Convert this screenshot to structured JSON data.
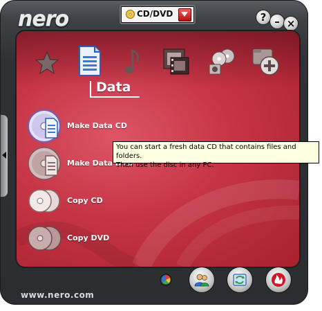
{
  "app": {
    "logo_text": "nero",
    "footer_url": "www.nero.com"
  },
  "mode_selector": {
    "selected": "CD/DVD",
    "icon": "cd-dvd-disc-icon"
  },
  "window_controls": {
    "help": "?",
    "minimize": "–",
    "close": "×"
  },
  "categories": [
    {
      "id": "favorites",
      "icon": "star-icon"
    },
    {
      "id": "data",
      "icon": "document-icon",
      "selected": true
    },
    {
      "id": "audio",
      "icon": "music-note-icon"
    },
    {
      "id": "photo-video",
      "icon": "film-icon"
    },
    {
      "id": "copy-backup",
      "icon": "discs-icon"
    },
    {
      "id": "extras",
      "icon": "add-icon"
    }
  ],
  "section": {
    "title": "Data"
  },
  "tasks": [
    {
      "label": "Make Data CD",
      "icon": "data-cd-icon",
      "hovered": true
    },
    {
      "label": "Make Data DVD",
      "icon": "data-dvd-icon"
    },
    {
      "label": "Copy CD",
      "icon": "copy-cd-icon"
    },
    {
      "label": "Copy DVD",
      "icon": "copy-dvd-icon"
    }
  ],
  "tooltip": {
    "line1": "You can start a fresh data CD that contains files and folders.",
    "line2": "Then use the disc in any PC."
  },
  "bottom_buttons": [
    {
      "icon": "color-dot-icon"
    },
    {
      "icon": "users-icon"
    },
    {
      "icon": "refresh-icon"
    },
    {
      "icon": "nero-flame-icon"
    }
  ],
  "colors": {
    "panel_red": "#c53445",
    "frame_dark": "#2f3134",
    "tooltip_bg": "#ffffe1"
  }
}
